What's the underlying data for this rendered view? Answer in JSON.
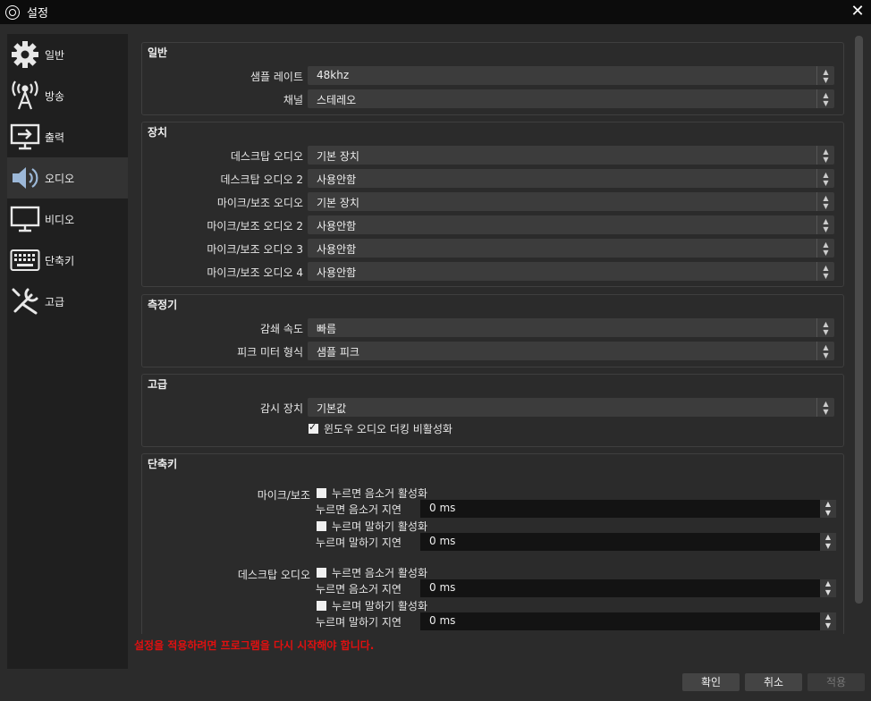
{
  "window": {
    "title": "설정"
  },
  "sidebar": {
    "items": [
      {
        "label": "일반",
        "icon": "gear-icon"
      },
      {
        "label": "방송",
        "icon": "broadcast-icon"
      },
      {
        "label": "출력",
        "icon": "output-icon"
      },
      {
        "label": "오디오",
        "icon": "speaker-icon",
        "active": true
      },
      {
        "label": "비디오",
        "icon": "monitor-icon"
      },
      {
        "label": "단축키",
        "icon": "keyboard-icon"
      },
      {
        "label": "고급",
        "icon": "tools-icon"
      }
    ]
  },
  "general": {
    "title": "일반",
    "sample_rate": {
      "label": "샘플 레이트",
      "value": "48khz"
    },
    "channels": {
      "label": "채널",
      "value": "스테레오"
    }
  },
  "devices": {
    "title": "장치",
    "rows": [
      {
        "label": "데스크탑 오디오",
        "value": "기본 장치"
      },
      {
        "label": "데스크탑 오디오 2",
        "value": "사용안함"
      },
      {
        "label": "마이크/보조 오디오",
        "value": "기본 장치"
      },
      {
        "label": "마이크/보조 오디오 2",
        "value": "사용안함"
      },
      {
        "label": "마이크/보조 오디오 3",
        "value": "사용안함"
      },
      {
        "label": "마이크/보조 오디오 4",
        "value": "사용안함"
      }
    ]
  },
  "meters": {
    "title": "측정기",
    "decay": {
      "label": "감쇄 속도",
      "value": "빠름"
    },
    "peak": {
      "label": "피크 미터 형식",
      "value": "샘플 피크"
    }
  },
  "advanced": {
    "title": "고급",
    "monitor": {
      "label": "감시 장치",
      "value": "기본값"
    },
    "ducking": {
      "label": "윈도우 오디오 더킹 비활성화",
      "checked": true
    }
  },
  "hotkeys": {
    "title": "단축키",
    "sources": [
      {
        "name": "마이크/보조",
        "ptm_check": "누르면 음소거 활성화",
        "ptm_delay_label": "누르면 음소거 지연",
        "ptm_delay": "0 ms",
        "ptt_check": "누르며 말하기 활성화",
        "ptt_delay_label": "누르며 말하기 지연",
        "ptt_delay": "0 ms"
      },
      {
        "name": "데스크탑 오디오",
        "ptm_check": "누르면 음소거 활성화",
        "ptm_delay_label": "누르면 음소거 지연",
        "ptm_delay": "0 ms",
        "ptt_check": "누르며 말하기 활성화",
        "ptt_delay_label": "누르며 말하기 지연",
        "ptt_delay": "0 ms"
      }
    ]
  },
  "warning": "설정을 적용하려면 프로그램을 다시 시작해야 합니다.",
  "buttons": {
    "ok": "확인",
    "cancel": "취소",
    "apply": "적용"
  },
  "colors": {
    "background": "#2b2b2b",
    "sidebar": "#1f1f1f",
    "warning": "#e01010"
  }
}
